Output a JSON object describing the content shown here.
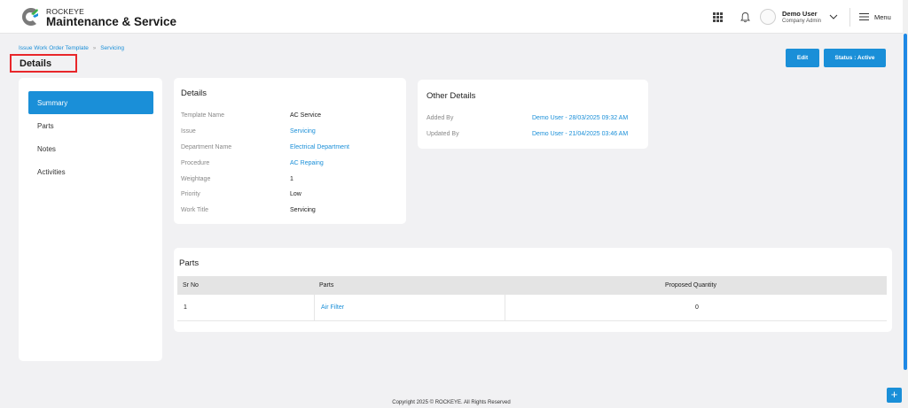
{
  "header": {
    "brand_small": "ROCKEYE",
    "brand_big": "Maintenance & Service",
    "user_name": "Demo User",
    "user_role": "Company Admin",
    "menu_label": "Menu"
  },
  "breadcrumb": {
    "items": [
      "Issue Work Order Template",
      "Servicing"
    ],
    "separator": "»"
  },
  "page_title": "Details",
  "actions": {
    "edit_label": "Edit",
    "status_label": "Status : Active"
  },
  "sidebar": {
    "items": [
      {
        "label": "Summary",
        "active": true
      },
      {
        "label": "Parts",
        "active": false
      },
      {
        "label": "Notes",
        "active": false
      },
      {
        "label": "Activities",
        "active": false
      }
    ]
  },
  "details": {
    "title": "Details",
    "rows": [
      {
        "label": "Template Name",
        "value": "AC Service",
        "link": false
      },
      {
        "label": "Issue",
        "value": "Servicing",
        "link": true
      },
      {
        "label": "Department Name",
        "value": "Electrical Department",
        "link": true
      },
      {
        "label": "Procedure",
        "value": "AC Repaing",
        "link": true
      },
      {
        "label": "Weightage",
        "value": "1",
        "link": false
      },
      {
        "label": "Priority",
        "value": "Low",
        "link": false
      },
      {
        "label": "Work Title",
        "value": "Servicing",
        "link": false
      }
    ]
  },
  "other_details": {
    "title": "Other Details",
    "rows": [
      {
        "label": "Added By",
        "value": "Demo User - 28/03/2025 09:32 AM"
      },
      {
        "label": "Updated By",
        "value": "Demo User - 21/04/2025 03:46 AM"
      }
    ]
  },
  "parts": {
    "title": "Parts",
    "columns": [
      "Sr No",
      "Parts",
      "Proposed Quantity"
    ],
    "rows": [
      {
        "sr_no": "1",
        "part": "Air Filter",
        "qty": "0"
      }
    ]
  },
  "footer": "Copyright 2025 © ROCKEYE. All Rights Reserved",
  "fab_label": "+",
  "colors": {
    "accent": "#1a8fd8",
    "highlight_border": "#e8262a",
    "background": "#f1f1f3"
  }
}
